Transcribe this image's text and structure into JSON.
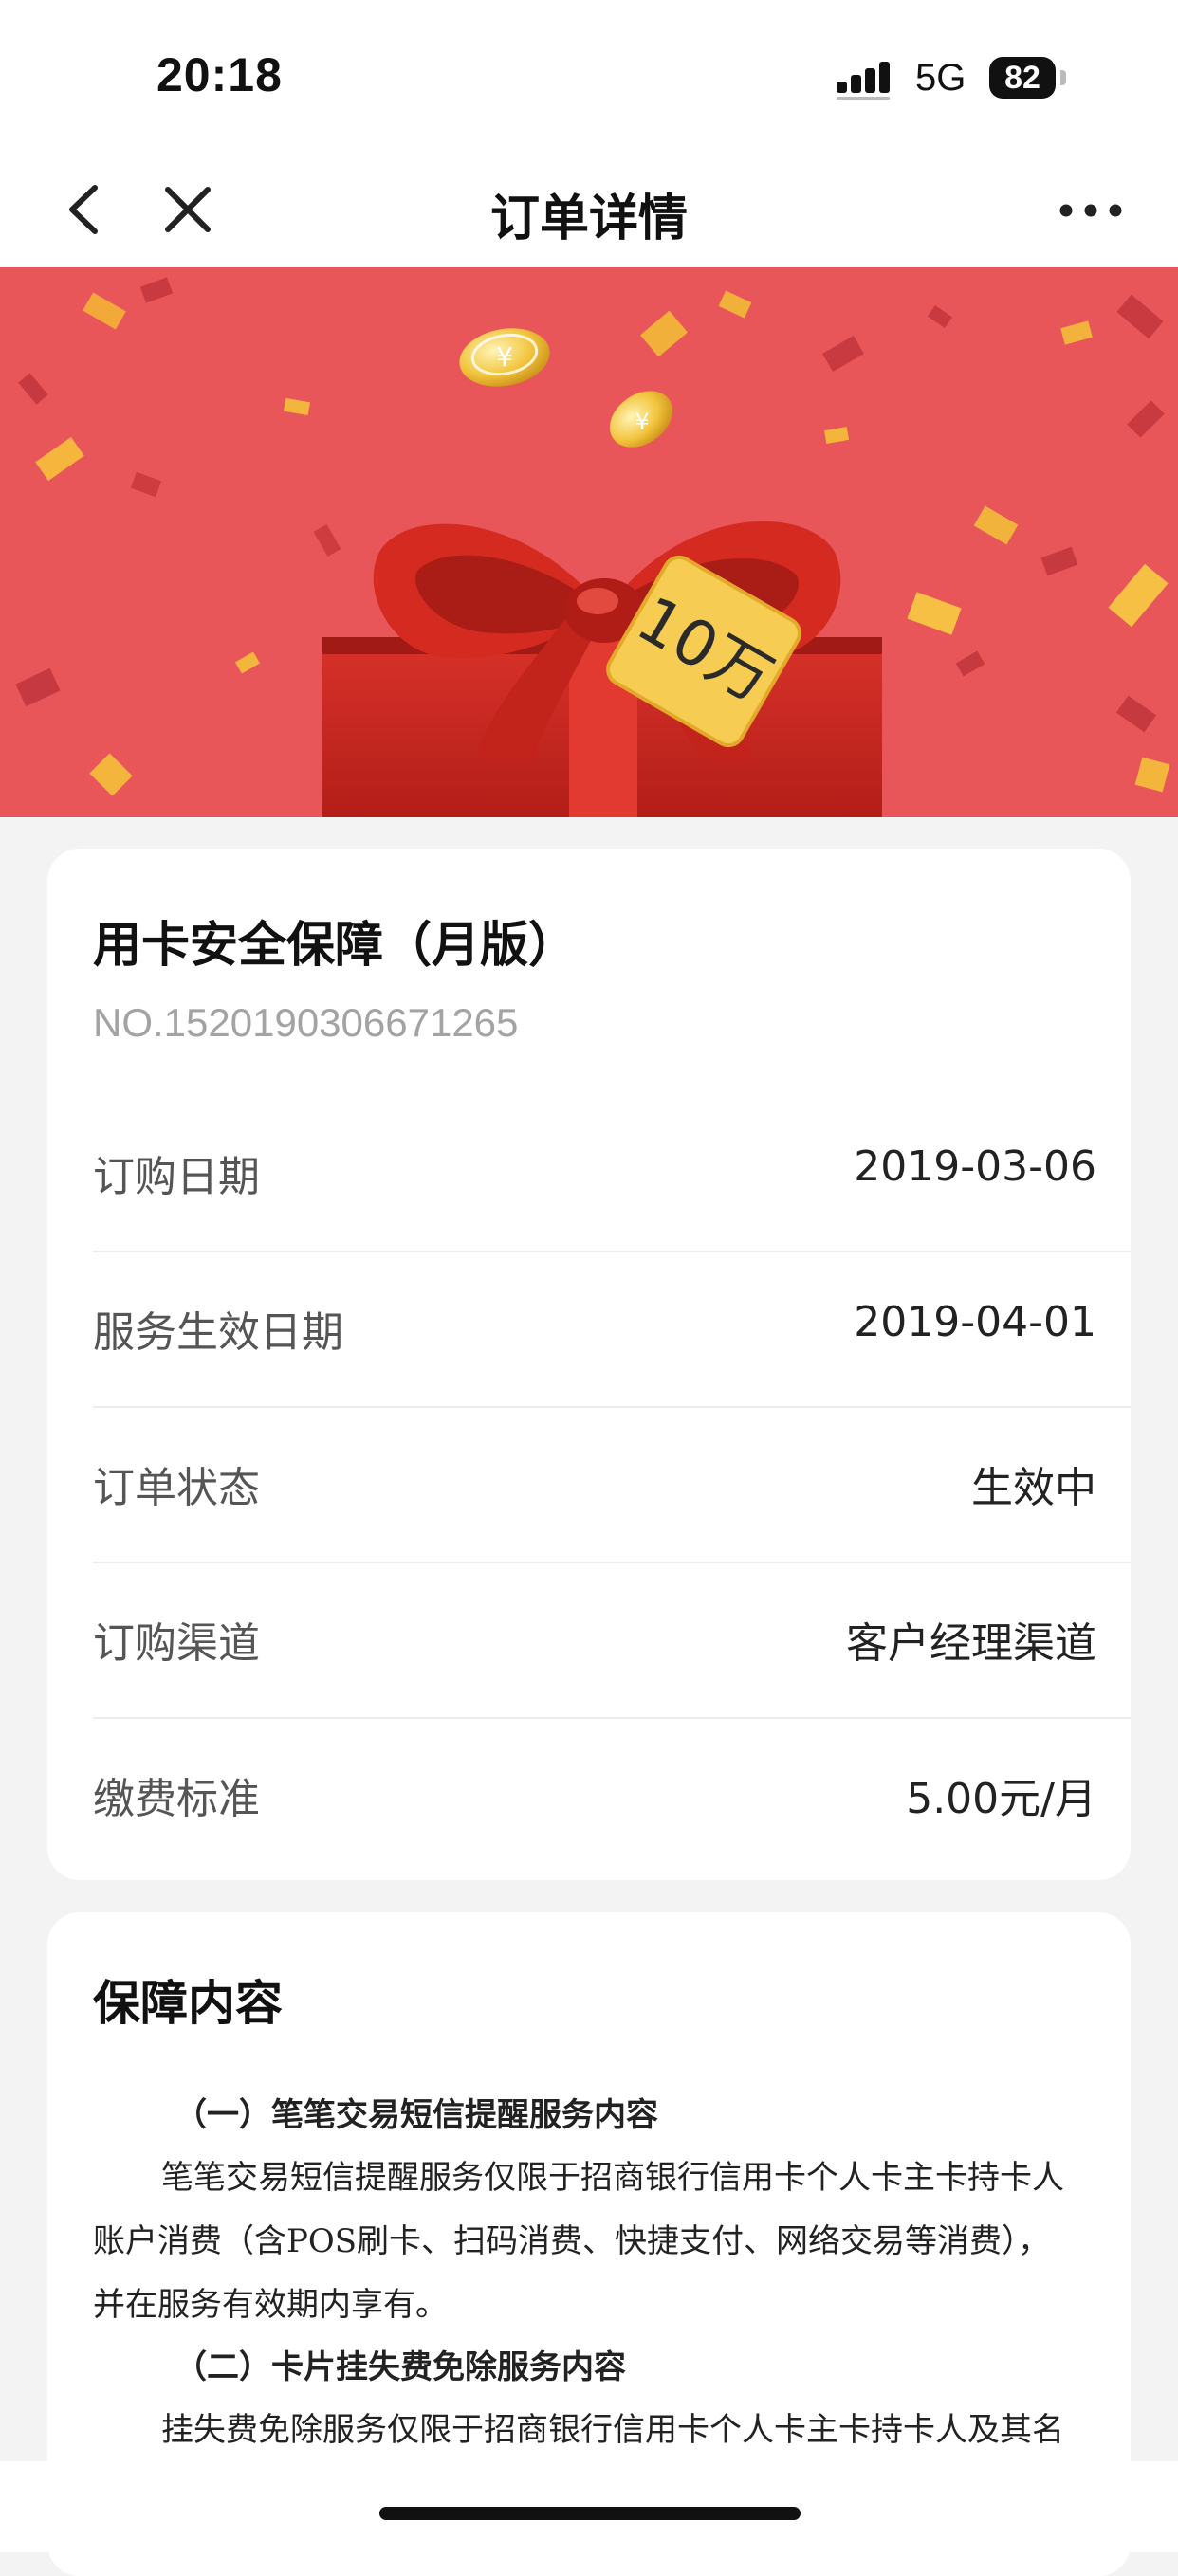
{
  "status_bar": {
    "time": "20:18",
    "network": "5G",
    "battery": "82"
  },
  "nav": {
    "title": "订单详情",
    "back_icon": "chevron-left-icon",
    "close_icon": "close-icon",
    "more_icon": "more-dots-icon"
  },
  "banner": {
    "tag_text": "10万",
    "colors": {
      "background": "#e8565a",
      "ribbon": "#d42a20",
      "tag": "#f6cc52"
    }
  },
  "order": {
    "product_name": "用卡安全保障（月版）",
    "order_no": "NO.1520190306671265",
    "rows": [
      {
        "label": "订购日期",
        "value": "2019-03-06"
      },
      {
        "label": "服务生效日期",
        "value": "2019-04-01"
      },
      {
        "label": "订单状态",
        "value": "生效中"
      },
      {
        "label": "订购渠道",
        "value": "客户经理渠道"
      },
      {
        "label": "缴费标准",
        "value": "5.00元/月"
      }
    ]
  },
  "coverage": {
    "title": "保障内容",
    "sections": [
      {
        "heading": "（一）笔笔交易短信提醒服务内容",
        "lines": [
          "笔笔交易短信提醒服务仅限于招商银行信用卡个人卡主卡持卡人",
          "账户消费（含POS刷卡、扫码消费、快捷支付、网络交易等消费），",
          "并在服务有效期内享有。"
        ]
      },
      {
        "heading": "（二）卡片挂失费免除服务内容",
        "lines": [
          "挂失费免除服务仅限于招商银行信用卡个人卡主卡持卡人及其名"
        ]
      }
    ]
  }
}
